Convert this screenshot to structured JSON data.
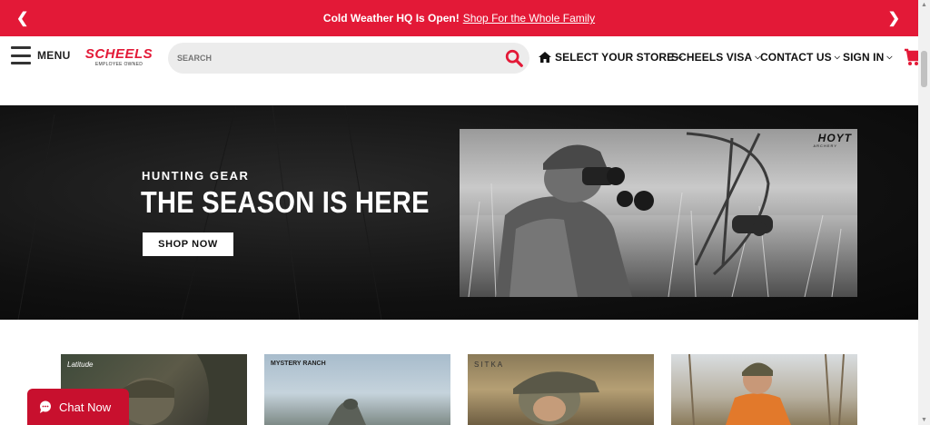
{
  "promo": {
    "text": "Cold Weather HQ Is Open!",
    "link": "Shop For the Whole Family",
    "prev_icon": "chevron-left-icon",
    "next_icon": "chevron-right-icon"
  },
  "header": {
    "menu_label": "MENU",
    "logo_name": "SCHEELS",
    "logo_tag": "EMPLOYEE OWNED",
    "search_placeholder": "SEARCH",
    "nav": {
      "store": "SELECT YOUR STORE",
      "visa": "SCHEELS VISA",
      "contact": "CONTACT US",
      "signin": "SIGN IN"
    }
  },
  "hero": {
    "kicker": "HUNTING GEAR",
    "headline": "THE SEASON IS HERE",
    "cta": "SHOP NOW",
    "image_brand": "HOYT",
    "image_brand_sub": "ARCHERY"
  },
  "tiles": [
    {
      "brand": "Latitude"
    },
    {
      "brand": "MYSTERY RANCH"
    },
    {
      "brand": "SITKA"
    },
    {
      "brand": ""
    }
  ],
  "chat": {
    "label": "Chat Now"
  },
  "colors": {
    "brand_red": "#e31937",
    "chat_red": "#c8102e"
  }
}
